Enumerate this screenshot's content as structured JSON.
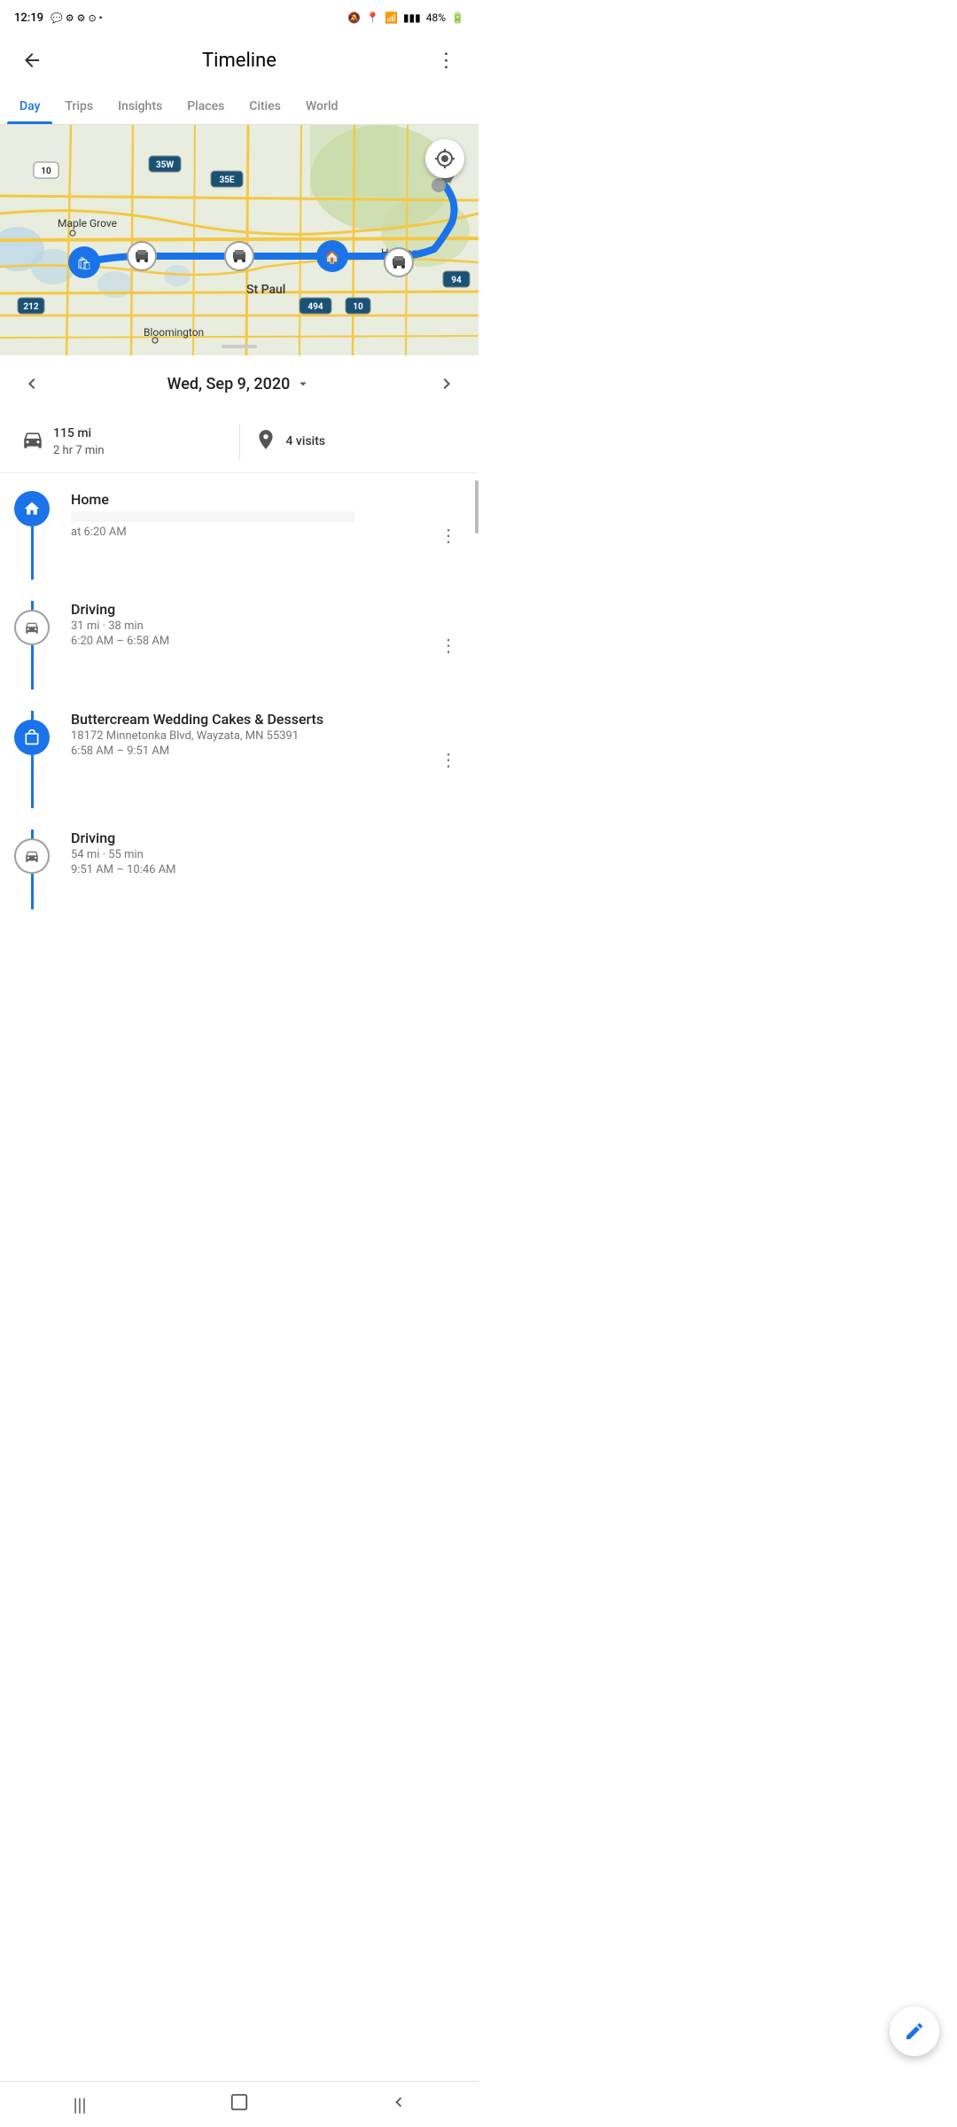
{
  "statusBar": {
    "time": "12:19",
    "battery": "48%"
  },
  "header": {
    "title": "Timeline",
    "back_label": "←",
    "more_label": "⋮"
  },
  "tabs": [
    {
      "id": "day",
      "label": "Day",
      "active": true
    },
    {
      "id": "trips",
      "label": "Trips",
      "active": false
    },
    {
      "id": "insights",
      "label": "Insights",
      "active": false
    },
    {
      "id": "places",
      "label": "Places",
      "active": false
    },
    {
      "id": "cities",
      "label": "Cities",
      "active": false
    },
    {
      "id": "world",
      "label": "World",
      "active": false
    }
  ],
  "map": {
    "location_btn_label": "📍"
  },
  "dateNav": {
    "prev_label": "‹",
    "next_label": "›",
    "date": "Wed, Sep 9, 2020",
    "dropdown_icon": "▼"
  },
  "stats": {
    "distance": "115 mi",
    "duration": "2 hr 7 min",
    "visits": "4 visits"
  },
  "timeline": [
    {
      "type": "place",
      "icon": "home",
      "icon_type": "blue",
      "title": "Home",
      "subtitle": "",
      "time": "at 6:20 AM",
      "has_more": true
    },
    {
      "type": "driving",
      "icon": "car",
      "icon_type": "white",
      "title": "Driving",
      "subtitle": "31 mi · 38 min",
      "time": "6:20 AM – 6:58 AM",
      "has_more": true
    },
    {
      "type": "place",
      "icon": "shopping",
      "icon_type": "blue",
      "title": "Buttercream Wedding Cakes & Desserts",
      "subtitle": "18172 Minnetonka Blvd, Wayzata, MN 55391",
      "time": "6:58 AM – 9:51 AM",
      "has_more": true
    },
    {
      "type": "driving",
      "icon": "car",
      "icon_type": "white",
      "title": "Driving",
      "subtitle": "54 mi · 55 min",
      "time": "9:51 AM – 10:46 AM",
      "has_more": false
    }
  ],
  "fab": {
    "icon": "✏️",
    "label": "Edit"
  },
  "bottomNav": {
    "items": [
      "|||",
      "□",
      "‹"
    ]
  }
}
